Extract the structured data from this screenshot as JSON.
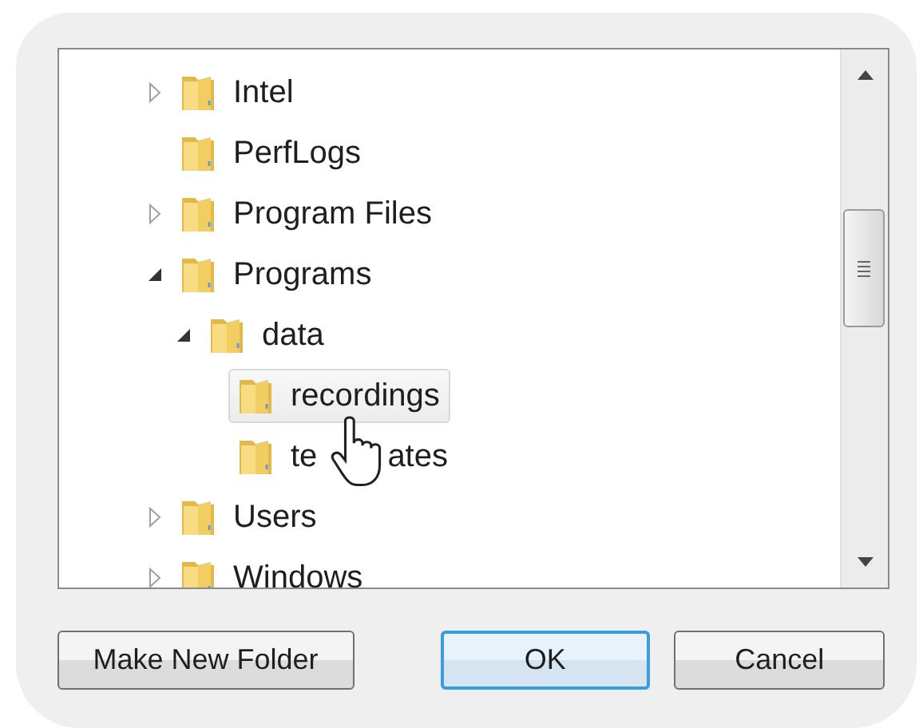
{
  "tree": [
    {
      "label": "Intel",
      "expandable": true,
      "expanded": false,
      "selected": false
    },
    {
      "label": "PerfLogs",
      "expandable": false,
      "selected": false
    },
    {
      "label": "Program Files",
      "expandable": true,
      "expanded": false,
      "selected": false
    },
    {
      "label": "Programs",
      "expandable": true,
      "expanded": true,
      "selected": false,
      "children": [
        {
          "label": "data",
          "expandable": true,
          "expanded": true,
          "selected": false,
          "children": [
            {
              "label": "recordings",
              "expandable": false,
              "selected": true
            },
            {
              "label_parts": [
                "te",
                "ates"
              ],
              "expandable": false,
              "selected": false
            }
          ]
        }
      ]
    },
    {
      "label": "Users",
      "expandable": true,
      "expanded": false,
      "selected": false
    },
    {
      "label": "Windows",
      "expandable": true,
      "expanded": false,
      "selected": false
    }
  ],
  "buttons": [
    {
      "label": "Make New Folder",
      "default": false
    },
    {
      "label": "OK",
      "default": true
    },
    {
      "label": "Cancel",
      "default": false
    }
  ]
}
